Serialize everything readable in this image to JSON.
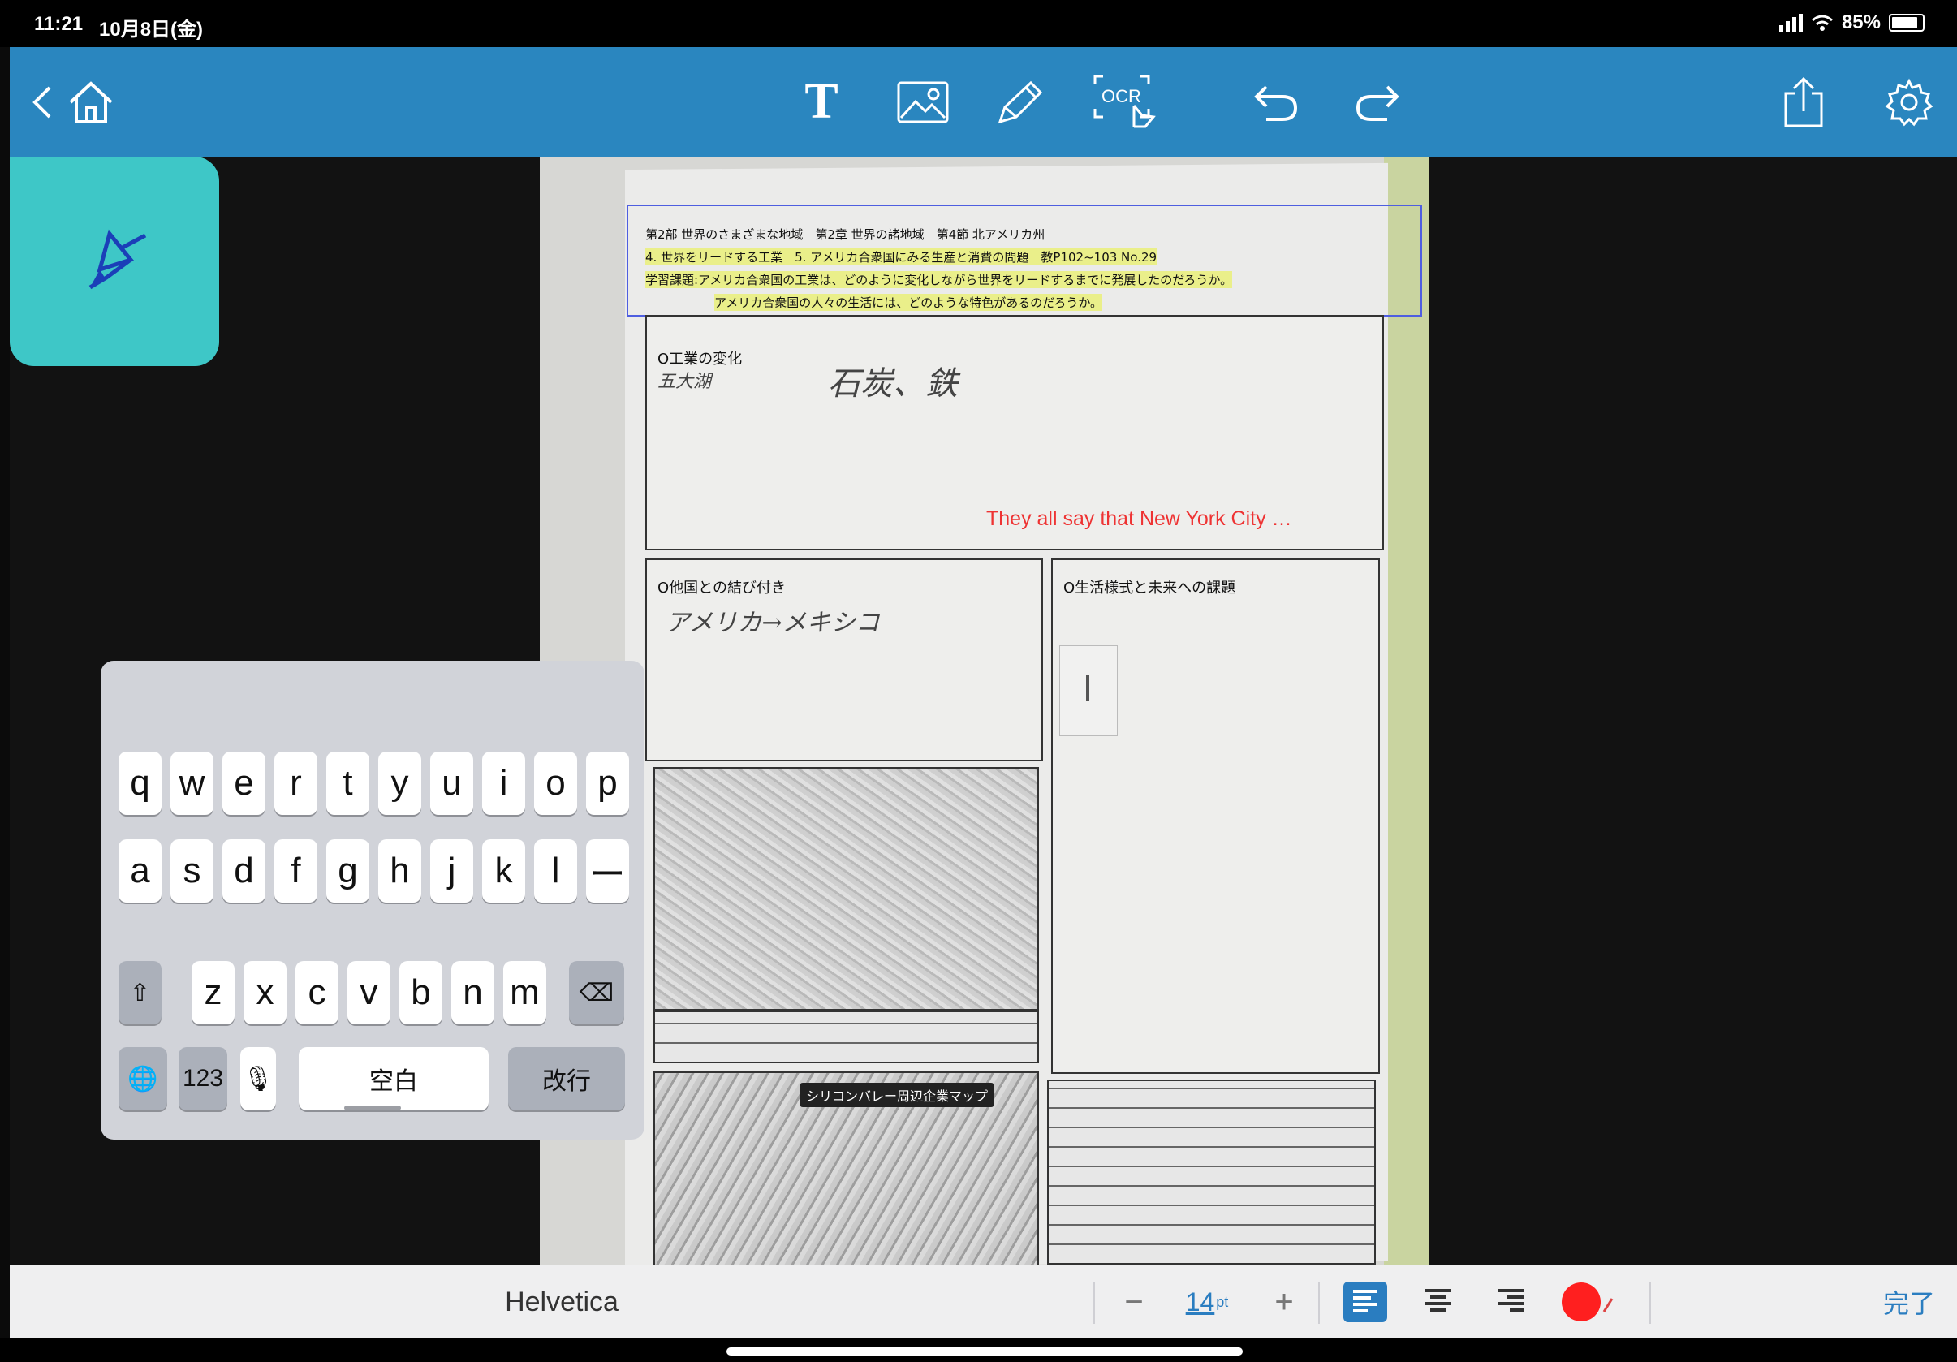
{
  "status_bar": {
    "time": "11:21",
    "date": "10月8日(金)",
    "battery_percent": "85%",
    "battery_level": 0.85
  },
  "toolbar": {
    "icons": [
      "back-chevron-icon",
      "home-icon",
      "text-tool-icon",
      "image-tool-icon",
      "pen-tool-icon",
      "ocr-tool-icon",
      "undo-icon",
      "redo-icon",
      "share-icon",
      "settings-icon"
    ],
    "text_tool_label": "T",
    "ocr_label": "OCR"
  },
  "tool_panel": {
    "active_tool": "highlighter-pen",
    "tile_color": "#3ec7c7"
  },
  "document": {
    "header_line1": "第2部 世界のさまざまな地域　第2章 世界の諸地域　第4節 北アメリカ州",
    "header_line2": "4. 世界をリードする工業　5. アメリカ合衆国にみる生産と消費の問題　教P102~103 No.29",
    "header_line3": "学習課題:アメリカ合衆国の工業は、どのように変化しながら世界をリードするまでに発展したのだろうか。",
    "header_line4": "アメリカ合衆国の人々の生活には、どのような特色があるのだろうか。",
    "section1_title": "O工業の変化",
    "section1_note1": "五大湖",
    "section1_note2": "石炭、鉄",
    "section2_title": "O他国との結び付き",
    "section2_note": "アメリカ→メキシコ",
    "section3_title": "O生活様式と未来への課題",
    "map_label": "シリコンバレー周辺企業マップ",
    "red_annotation": "They all say that New York City …",
    "annotation_color": "#ee3333"
  },
  "keyboard": {
    "row1": [
      "q",
      "w",
      "e",
      "r",
      "t",
      "y",
      "u",
      "i",
      "o",
      "p"
    ],
    "row2": [
      "a",
      "s",
      "d",
      "f",
      "g",
      "h",
      "j",
      "k",
      "l",
      "ー"
    ],
    "row3": [
      "z",
      "x",
      "c",
      "v",
      "b",
      "n",
      "m"
    ],
    "shift_label": "⇧",
    "delete_label": "⌫",
    "globe_label": "🌐",
    "numbers_label": "123",
    "mic_label": "🎙",
    "space_label": "空白",
    "return_label": "改行"
  },
  "format_bar": {
    "font_name": "Helvetica",
    "minus_label": "−",
    "size_value": "14",
    "size_unit": "pt",
    "plus_label": "+",
    "text_color": "#ff1f1f",
    "done_label": "完了"
  }
}
